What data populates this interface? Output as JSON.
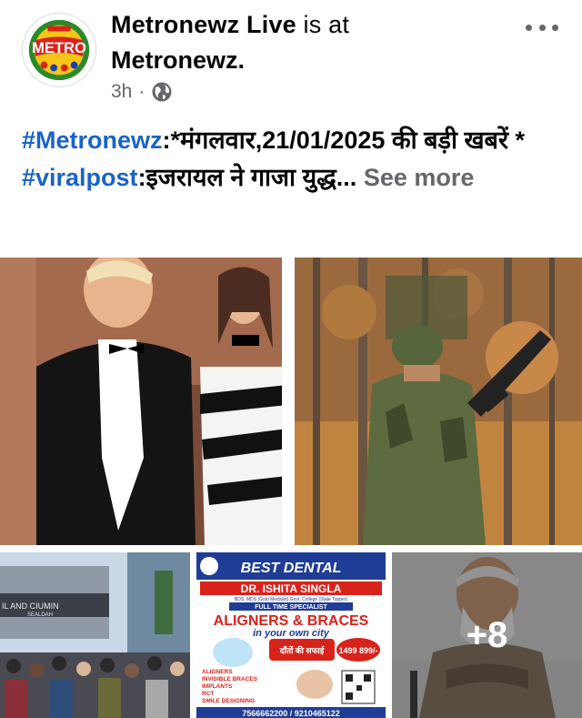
{
  "post": {
    "page_name": "Metronewz Live",
    "is_at": " is at",
    "location": "Metronewz.",
    "time": "3h",
    "separator": "·",
    "privacy_icon": "globe-icon",
    "more_icon": "more-options-icon",
    "avatar_text": "METRO",
    "text": {
      "hashtag1": "#Metronewz",
      "line1_rest": ":*मंगलवार,21/01/2025 की बड़ी खबरें *",
      "hashtag2": "#viralpost",
      "line2_rest": ":इजरायल ने गाजा युद्ध...",
      "see_more": "See more"
    }
  },
  "photos": {
    "ad": {
      "title": "BEST DENTAL",
      "doctor": "DR. ISHITA SINGLA",
      "quals": "BDS, MDS (Gold Medalist) Govt. College (State Topper)",
      "specialist": "FULL TIME SPECIALIST",
      "headline": "ALIGNERS & BRACES",
      "subhead": "in your own city",
      "offer": "दाँतों की सफाई",
      "price": "1499 899/-",
      "list": [
        "ALIGNERS",
        "INVISIBLE BRACES",
        "IMPLANTS",
        "RCT",
        "SMILE DESIGNING"
      ],
      "phone": "7566662200 / 9210465122"
    },
    "crowd_sign": "IL AND CIUMIN",
    "crowd_sign2": "SEALDAH",
    "more_count": "+8"
  },
  "colors": {
    "hashtag": "#1a63c8",
    "secondary_text": "#65676b"
  }
}
